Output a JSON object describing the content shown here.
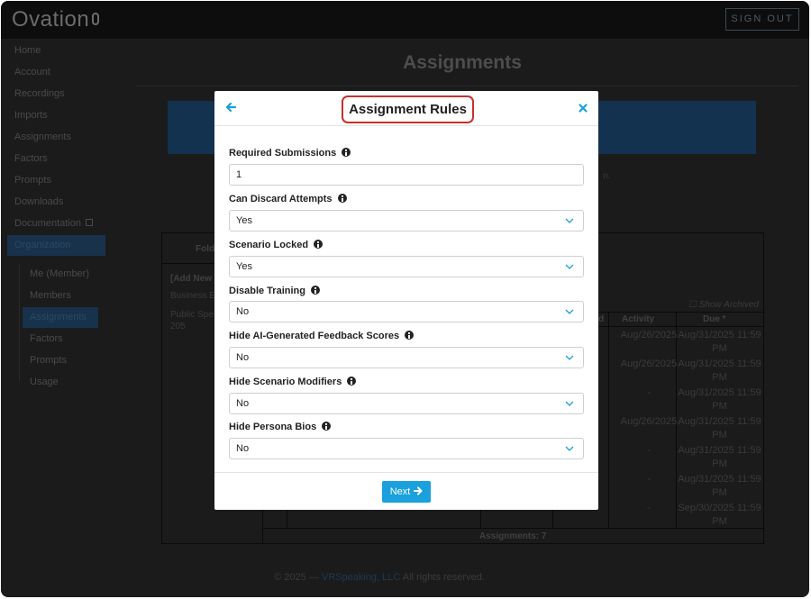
{
  "app": {
    "logo": "Ovation",
    "sign_out": "SIGN OUT"
  },
  "sidebar": {
    "items": [
      {
        "label": "Home"
      },
      {
        "label": "Account"
      },
      {
        "label": "Recordings"
      },
      {
        "label": "Imports"
      },
      {
        "label": "Assignments"
      },
      {
        "label": "Factors"
      },
      {
        "label": "Prompts"
      },
      {
        "label": "Downloads"
      },
      {
        "label": "Documentation"
      },
      {
        "label": "Organization"
      }
    ],
    "sub_items": [
      {
        "label": "Me (Member)"
      },
      {
        "label": "Members"
      },
      {
        "label": "Assignments"
      },
      {
        "label": "Factors"
      },
      {
        "label": "Prompts"
      },
      {
        "label": "Usage"
      }
    ]
  },
  "page": {
    "title": "Assignments"
  },
  "background_table": {
    "folder_header": "Fold",
    "add_new": "[Add New",
    "row_a": "Business E",
    "row_b": "Public Spe",
    "row_c": "205",
    "show_archived": "Show Archived",
    "col_d": "d",
    "col_activity": "Activity",
    "col_due": "Due *",
    "activity": [
      "Aug/26/2025",
      "Aug/26/2025",
      "-",
      "Aug/26/2025",
      "-",
      "-",
      "-"
    ],
    "due_line1": [
      "Aug/31/2025 11:59",
      "Aug/31/2025 11:59",
      "Aug/31/2025 11:59",
      "Aug/31/2025 11:59",
      "Aug/31/2025 11:59",
      "Aug/31/2025 11:59",
      "Sep/30/2025 11:59"
    ],
    "due_line2": [
      "PM",
      "PM",
      "PM",
      "PM",
      "PM",
      "PM",
      "PM"
    ],
    "count": "Assignments: 7",
    "hint": "n."
  },
  "footer": {
    "prefix": "© 2025 — ",
    "company": "VRSpeaking, LLC",
    "suffix": " All rights reserved."
  },
  "modal": {
    "title": "Assignment Rules",
    "next_label": "Next",
    "fields": {
      "required_submissions": {
        "label": "Required Submissions",
        "value": "1"
      },
      "can_discard": {
        "label": "Can Discard Attempts",
        "value": "Yes"
      },
      "scenario_locked": {
        "label": "Scenario Locked",
        "value": "Yes"
      },
      "disable_training": {
        "label": "Disable Training",
        "value": "No"
      },
      "hide_ai_scores": {
        "label": "Hide AI-Generated Feedback Scores",
        "value": "No"
      },
      "hide_modifiers": {
        "label": "Hide Scenario Modifiers",
        "value": "No"
      },
      "hide_persona_bios": {
        "label": "Hide Persona Bios",
        "value": "No"
      }
    }
  },
  "colors": {
    "accent": "#1aa0dc",
    "highlight": "#c9302c"
  },
  "icons": [
    "back-arrow-icon",
    "close-icon",
    "info-icon",
    "chevron-down-icon",
    "arrow-right-icon",
    "external-link-icon"
  ]
}
